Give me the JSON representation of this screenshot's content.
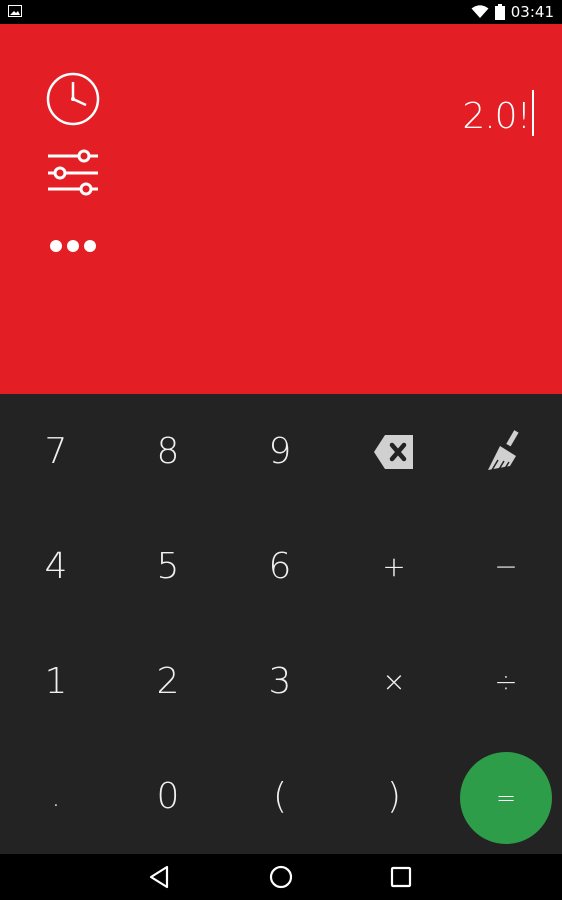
{
  "colors": {
    "accent": "#E31E25",
    "keypad_bg": "#232323",
    "equals_bg": "#2E9D49",
    "icon": "#FFFFFF",
    "key_icon": "#C8C8C8"
  },
  "status": {
    "time": "03:41"
  },
  "display": {
    "value": "2.0!"
  },
  "side_icons": [
    "history-icon",
    "settings-sliders-icon",
    "more-options-icon"
  ],
  "keys": {
    "row1": [
      "7",
      "8",
      "9"
    ],
    "row2": [
      "4",
      "5",
      "6",
      "+",
      "−"
    ],
    "row3": [
      "1",
      "2",
      "3",
      "×",
      "÷"
    ],
    "row4": [
      ".",
      "0",
      "(",
      ")"
    ],
    "equals": "="
  },
  "key_icons": {
    "backspace": "backspace-icon",
    "clear": "broom-clear-icon"
  },
  "nav": {
    "back": "back-icon",
    "home": "home-icon",
    "recents": "recents-icon"
  }
}
